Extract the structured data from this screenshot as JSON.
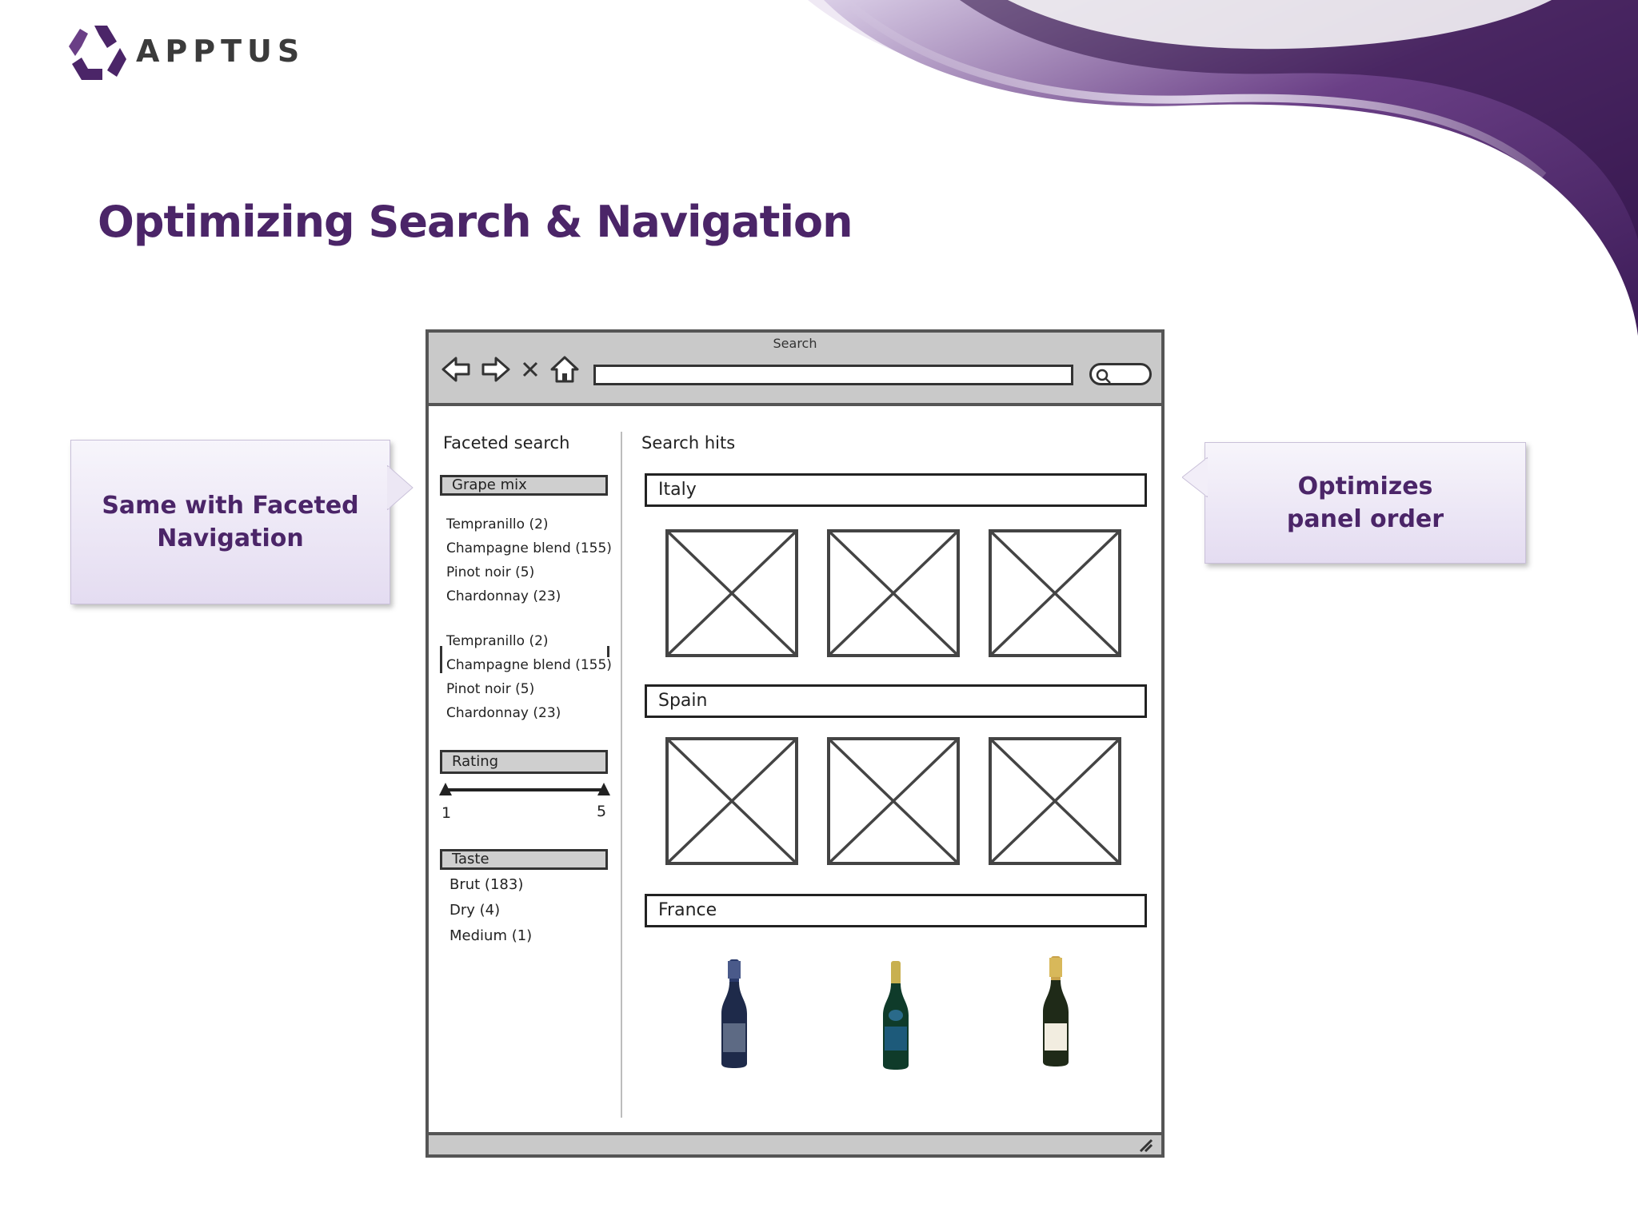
{
  "brand": {
    "name": "APPTUS",
    "colors": {
      "purple": "#4b2568",
      "swoosh": "#6a3f86"
    }
  },
  "slide": {
    "title": "Optimizing Search & Navigation"
  },
  "callouts": {
    "left": {
      "line1": "Same with Faceted",
      "line2": "Navigation"
    },
    "right": {
      "line1": "Optimizes",
      "line2": "panel order"
    }
  },
  "mockup": {
    "window_title": "Search",
    "toolbar_icons": [
      "back-arrow-icon",
      "forward-arrow-icon",
      "close-icon",
      "home-icon",
      "search-icon"
    ],
    "sidebar": {
      "title": "Faceted search",
      "facets": [
        {
          "label": "Grape mix",
          "items": [
            "Tempranillo (2)",
            "Champagne blend (155)",
            "Pinot noir (5)",
            "Chardonnay (23)"
          ]
        },
        {
          "label": "",
          "items": [
            "Tempranillo (2)",
            "Champagne blend (155)",
            "Pinot noir (5)",
            "Chardonnay (23)"
          ]
        },
        {
          "label": "Rating",
          "range_min": "1",
          "range_max": "5"
        },
        {
          "label": "Taste",
          "items": [
            "Brut (183)",
            "Dry (4)",
            "Medium (1)"
          ]
        }
      ]
    },
    "results": {
      "title": "Search hits",
      "groups": [
        {
          "label": "Italy",
          "content": "image-placeholders"
        },
        {
          "label": "Spain",
          "content": "image-placeholders"
        },
        {
          "label": "France",
          "content": "bottle-photos"
        }
      ]
    }
  }
}
